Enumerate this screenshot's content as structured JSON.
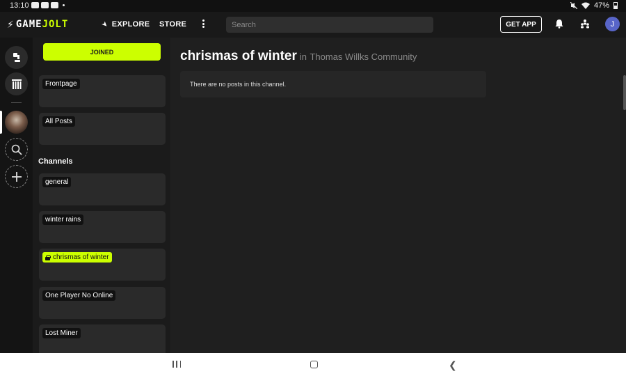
{
  "status_bar": {
    "time": "13:10",
    "battery": "47%",
    "battery_level": 0.47
  },
  "topnav": {
    "logo_text_a": "GAME",
    "logo_text_b": "JOLT",
    "explore_label": "EXPLORE",
    "store_label": "STORE",
    "search_placeholder": "Search",
    "get_app_label": "GET APP",
    "user_initial": "J"
  },
  "sidebar": {
    "joined_label": "JOINED",
    "feeds": [
      {
        "label": "Frontpage"
      },
      {
        "label": "All Posts"
      }
    ],
    "channels_heading": "Channels",
    "channels": [
      {
        "label": "general",
        "active": false
      },
      {
        "label": "winter rains",
        "active": false
      },
      {
        "label": "chrismas of winter",
        "active": true,
        "locked": true
      },
      {
        "label": "One Player No Online",
        "active": false
      },
      {
        "label": "Lost Miner",
        "active": false
      }
    ]
  },
  "main": {
    "channel_title": "chrismas of winter",
    "in_label": "in",
    "community_name": "Thomas Willks Community",
    "empty_message": "There are no posts in this channel."
  },
  "colors": {
    "accent": "#ccff00",
    "background": "#1f1f1f",
    "card": "#2a2a2a",
    "avatar": "#5865c8"
  }
}
